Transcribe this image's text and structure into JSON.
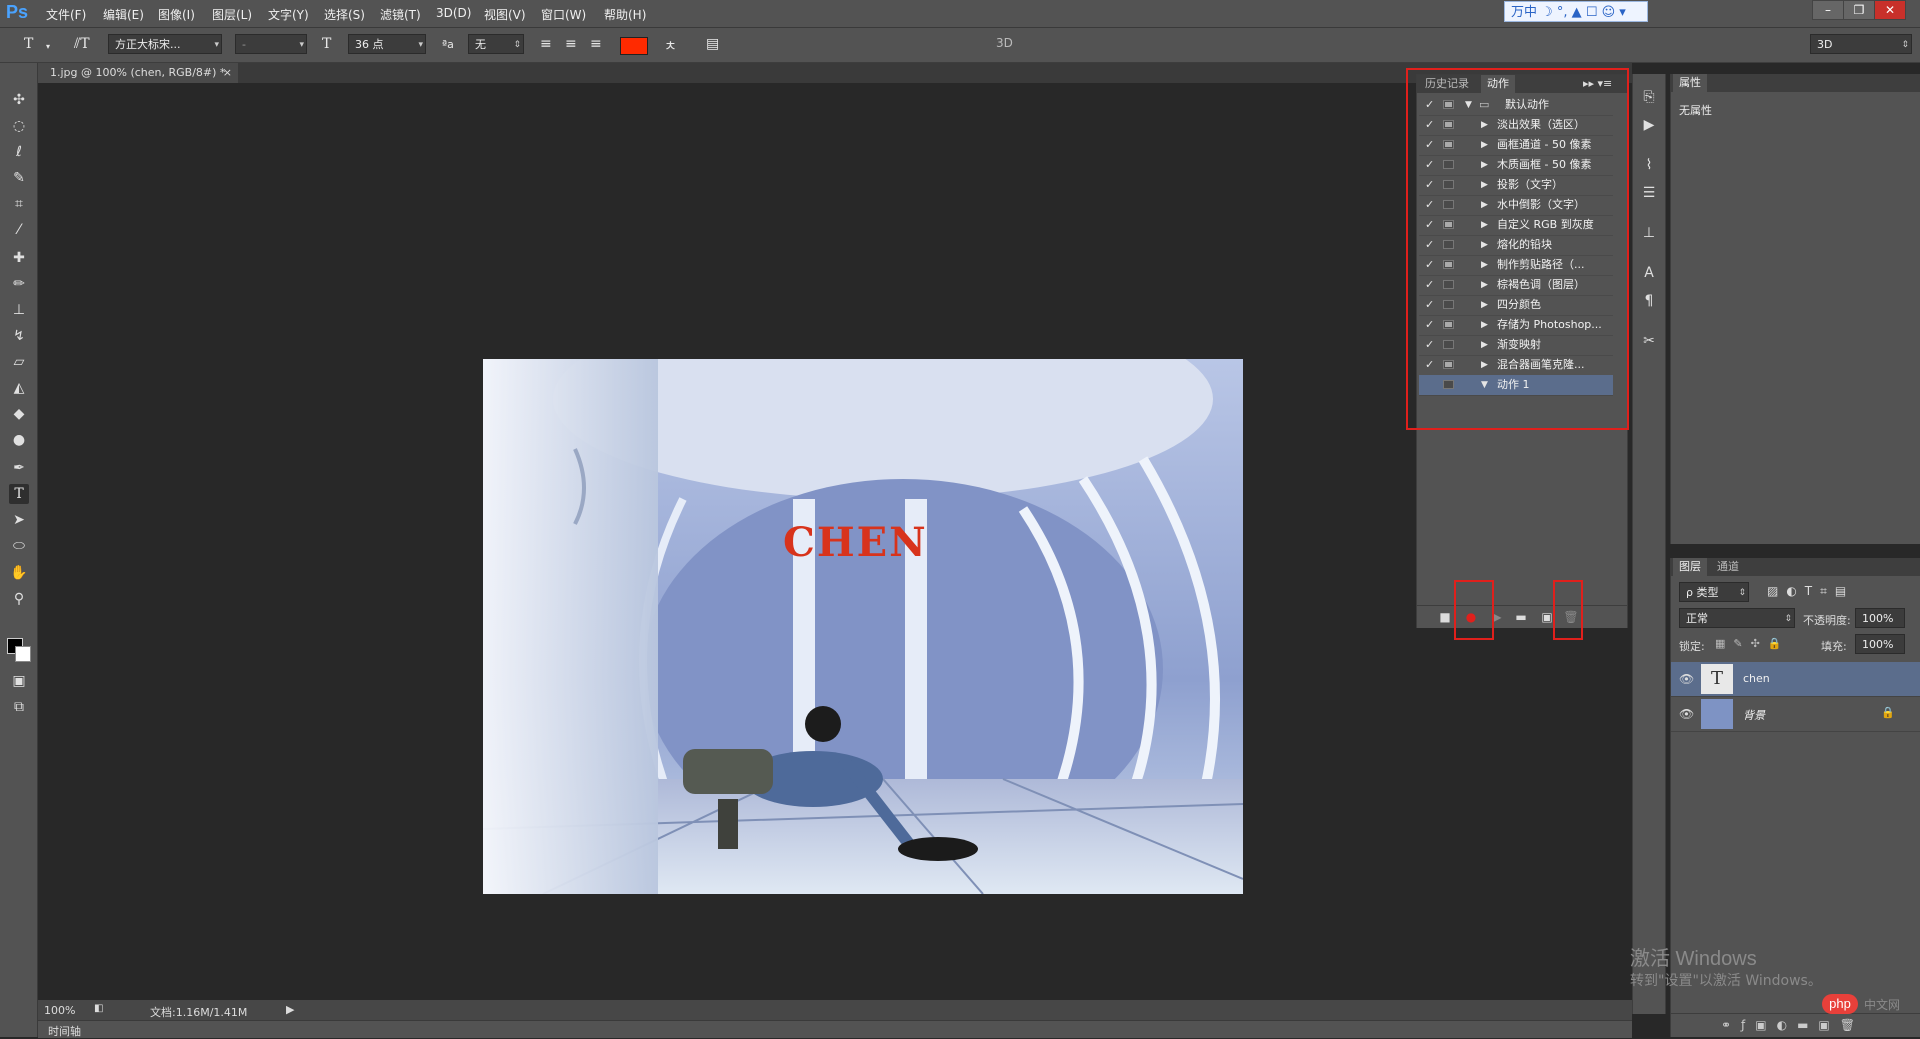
{
  "app": {
    "logo": "Ps"
  },
  "menu": [
    "文件(F)",
    "编辑(E)",
    "图像(I)",
    "图层(L)",
    "文字(Y)",
    "选择(S)",
    "滤镜(T)",
    "3D(D)",
    "视图(V)",
    "窗口(W)",
    "帮助(H)"
  ],
  "ime_bar": "万中 ☽ °, ▲ ☐ ☺ ▾",
  "window_controls": {
    "minimize": "–",
    "restore": "❐",
    "close": "✕"
  },
  "options_bar": {
    "font_family": "方正大标宋...",
    "font_style": "-",
    "font_size": "36 点",
    "antialias_label": "ªa",
    "antialias": "无",
    "text_color": "#ff2a00",
    "mode_3d": "3D",
    "workspace": "3D"
  },
  "document_tab": {
    "title": "1.jpg @ 100% (chen, RGB/8#) *",
    "close": "×"
  },
  "canvas": {
    "text_layer": "CHEN",
    "text_color": "#d8331c"
  },
  "status": {
    "zoom": "100%",
    "doc_info": "文档:1.16M/1.41M"
  },
  "timeline_label": "时间轴",
  "actions_panel": {
    "tabs": [
      "历史记录",
      "动作"
    ],
    "menu_icon": "▸▸ ▾≡",
    "set_name": "默认动作",
    "items": [
      {
        "label": "淡出效果（选区）",
        "dialog": true,
        "checked": true
      },
      {
        "label": "画框通道 - 50 像素",
        "dialog": true,
        "checked": true
      },
      {
        "label": "木质画框 - 50 像素",
        "dialog": false,
        "checked": true
      },
      {
        "label": "投影（文字）",
        "dialog": false,
        "checked": true
      },
      {
        "label": "水中倒影（文字）",
        "dialog": false,
        "checked": true
      },
      {
        "label": "自定义 RGB 到灰度",
        "dialog": true,
        "checked": true
      },
      {
        "label": "熔化的铅块",
        "dialog": false,
        "checked": true
      },
      {
        "label": "制作剪贴路径（...",
        "dialog": true,
        "checked": true
      },
      {
        "label": "棕褐色调（图层）",
        "dialog": false,
        "checked": true
      },
      {
        "label": "四分颜色",
        "dialog": false,
        "checked": true
      },
      {
        "label": "存储为 Photoshop...",
        "dialog": true,
        "checked": true
      },
      {
        "label": "渐变映射",
        "dialog": false,
        "checked": true
      },
      {
        "label": "混合器画笔克隆...",
        "dialog": true,
        "checked": true
      },
      {
        "label": "动作 1",
        "dialog": false,
        "checked": false,
        "selected": true,
        "expanded": true
      }
    ]
  },
  "properties_panel": {
    "tab": "属性",
    "empty_text": "无属性"
  },
  "layers_panel": {
    "tabs": [
      "图层",
      "通道"
    ],
    "filter": "ρ 类型",
    "blend_mode": "正常",
    "opacity_label": "不透明度:",
    "opacity": "100%",
    "lock_label": "锁定:",
    "fill_label": "填充:",
    "fill": "100%",
    "layers": [
      {
        "name": "chen",
        "type": "text",
        "thumb": "T",
        "selected": true
      },
      {
        "name": "背景",
        "type": "image",
        "thumb": "",
        "locked": true
      }
    ]
  },
  "watermark": {
    "line1": "激活 Windows",
    "line2": "转到\"设置\"以激活 Windows。"
  },
  "php_badge": "php",
  "php_site": "中文网"
}
